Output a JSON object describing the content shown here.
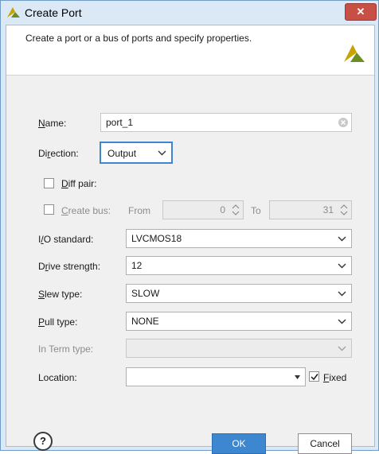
{
  "window": {
    "title": "Create Port",
    "close_label": "✕"
  },
  "header": {
    "description": "Create a port or a bus of ports and specify properties."
  },
  "form": {
    "name": {
      "label_mn": "N",
      "label_rest": "ame:",
      "value": "port_1"
    },
    "direction": {
      "label_pre": "Di",
      "label_mn": "r",
      "label_rest": "ection:",
      "value": "Output"
    },
    "diff_pair": {
      "label_mn": "D",
      "label_rest": "iff pair:",
      "checked": false
    },
    "create_bus": {
      "label_mn": "C",
      "label_rest": "reate bus:",
      "checked": false,
      "from_label": "From",
      "from_value": "0",
      "to_label": "To",
      "to_value": "31"
    },
    "io_standard": {
      "label_pre": "I",
      "label_mn": "/",
      "label_rest": "O standard:",
      "value": "LVCMOS18"
    },
    "drive_strength": {
      "label_pre": "D",
      "label_mn": "r",
      "label_rest": "ive strength:",
      "value": "12"
    },
    "slew_type": {
      "label_mn": "S",
      "label_rest": "lew type:",
      "value": "SLOW"
    },
    "pull_type": {
      "label_mn": "P",
      "label_rest": "ull type:",
      "value": "NONE"
    },
    "in_term_type": {
      "label": "In Term type:",
      "value": ""
    },
    "location": {
      "label": "Location:",
      "value": ""
    },
    "fixed": {
      "label_mn": "F",
      "label_rest": "ixed",
      "checked": true
    }
  },
  "footer": {
    "help_label": "?",
    "ok_label": "OK",
    "cancel_label": "Cancel"
  },
  "colors": {
    "accent": "#3c87d0",
    "logo_green": "#6b8e23",
    "logo_yellow": "#c8a400",
    "close_red": "#c74f45"
  }
}
